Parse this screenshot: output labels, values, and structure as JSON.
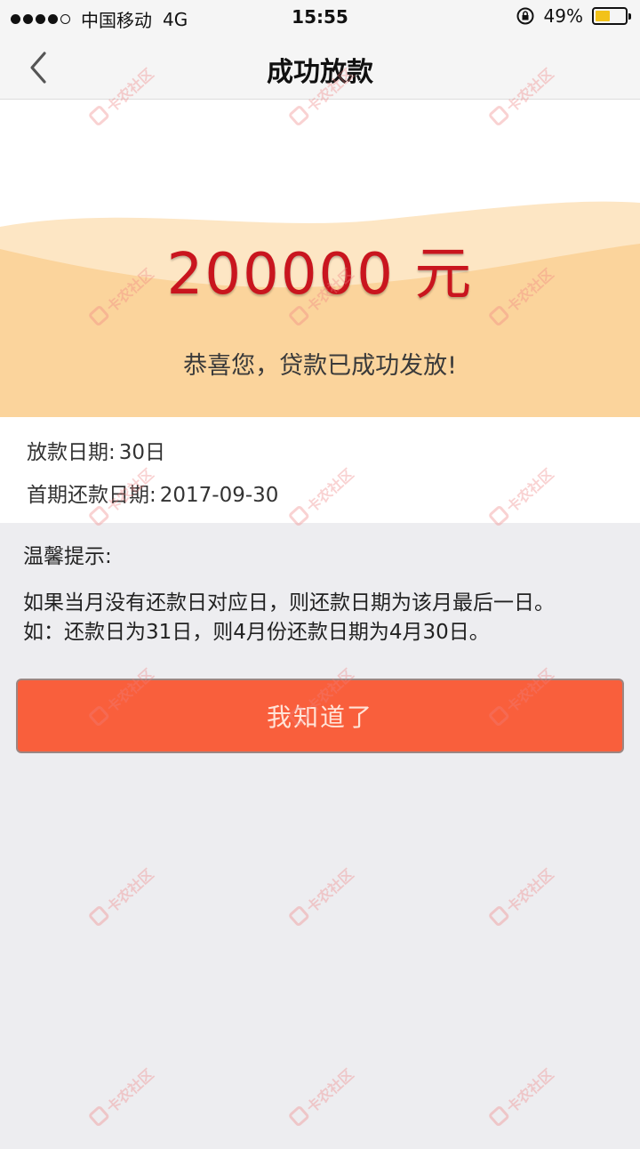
{
  "status_bar": {
    "carrier": "中国移动",
    "network": "4G",
    "time": "15:55",
    "battery_percent": "49%",
    "battery_level": 0.49,
    "battery_color": "#f2c21a"
  },
  "nav": {
    "back_icon": "chevron-left-icon",
    "title": "成功放款"
  },
  "hero": {
    "amount": "200000 元",
    "message": "恭喜您，贷款已成功发放!"
  },
  "loan_info": {
    "items": [
      {
        "label": "放款日期:",
        "value": "30日"
      },
      {
        "label": "首期还款日期:",
        "value": "2017-09-30"
      }
    ]
  },
  "tips": {
    "title": "温馨提示:",
    "lines": [
      "如果当月没有还款日对应日，则还款日期为该月最后一日。",
      "如：还款日为31日，则4月份还款日期为4月30日。"
    ]
  },
  "action": {
    "confirm_label": "我知道了"
  },
  "watermark": {
    "text": "卡农社区",
    "color": "#f08080"
  },
  "colors": {
    "amount": "#c9151e",
    "button": "#f95f3c",
    "hero_band": "#fbd49c"
  }
}
